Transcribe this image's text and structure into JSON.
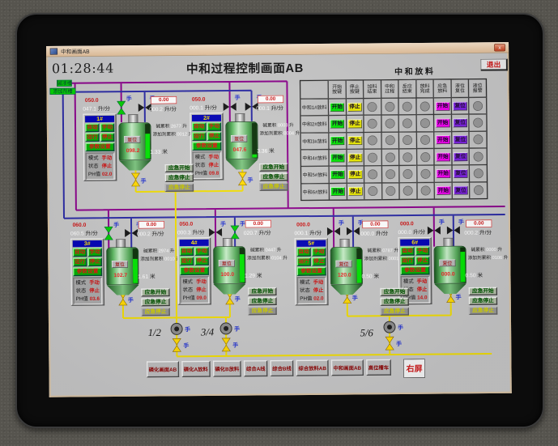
{
  "window": {
    "title": "中和画面AB",
    "clock": "01:28:44",
    "main_title": "中和过程控制画面AB",
    "exit": "退出",
    "close": "x"
  },
  "sources": {
    "box1": "碱液槽",
    "box2": "添加剂槽"
  },
  "labels": {
    "hand": "手",
    "auto": "自动",
    "manual": "手动",
    "run": "运行",
    "stop": "停止",
    "params": "参数设置",
    "mode": "模式",
    "state": "状态",
    "ph": "PH值",
    "reset": "复位",
    "em_start": "应急开始",
    "em_stop": "应急停止",
    "acc1": "碱累积",
    "acc2": "添加剂累积",
    "unit_vol": "升",
    "unit_flow": "升/分",
    "unit_level": "米"
  },
  "groups": [
    {
      "tag": "1#",
      "mode": "手动",
      "state": "停止",
      "ph": "02.0",
      "set": "050.0",
      "act": "047.1",
      "meter": "0.00",
      "meter_act": "000.2",
      "acc1": "2677",
      "acc2": "0012",
      "level": "098.2",
      "height": "1.33",
      "fill": 72
    },
    {
      "tag": "2#",
      "mode": "手动",
      "state": "停止",
      "ph": "09.8",
      "set": "050.0",
      "act": "000.1",
      "meter": "0.00",
      "meter_act": "000.1",
      "acc1": "0003",
      "acc2": "0004",
      "level": "047.6",
      "height": "3.36",
      "fill": 10
    },
    {
      "tag": "3#",
      "mode": "手动",
      "state": "停止",
      "ph": "03.6",
      "set": "060.0",
      "act": "060.5",
      "meter": "0.00",
      "meter_act": "000.2",
      "acc1": "2974",
      "acc2": "0010",
      "level": "102.7",
      "height": "1.61",
      "fill": 70
    },
    {
      "tag": "4#",
      "mode": "手动",
      "state": "停止",
      "ph": "09.0",
      "set": "050.0",
      "act": "000.3",
      "meter": "0.00",
      "meter_act": "020.7",
      "acc1": "0447",
      "acc2": "0104",
      "level": "100.0",
      "height": "1.29",
      "fill": 82
    },
    {
      "tag": "5#",
      "mode": "手动",
      "state": "停止",
      "ph": "02.0",
      "set": "000.0",
      "act": "000.1",
      "meter": "0.00",
      "meter_act": "000.0",
      "acc1": "0787",
      "acc2": "0001",
      "level": "120.0",
      "height": "0.50",
      "fill": 68
    },
    {
      "tag": "6#",
      "mode": "手动",
      "state": "停止",
      "ph": "14.0",
      "set": "000.0",
      "act": "000.0",
      "meter": "0.00",
      "meter_act": "000.2",
      "acc1": "0000",
      "acc2": "0106",
      "level": "000.0",
      "height": "0.50",
      "fill": 88
    }
  ],
  "pumps": [
    {
      "label": "1/2"
    },
    {
      "label": "3/4"
    },
    {
      "label": "5/6"
    }
  ],
  "table": {
    "title": "中和放料",
    "headers": [
      {
        "a": "开始",
        "b": "按键"
      },
      {
        "a": "停止",
        "b": "按键"
      },
      {
        "a": "加料",
        "b": "结束"
      },
      {
        "a": "中和",
        "b": "过程"
      },
      {
        "a": "反应",
        "b": "结束"
      },
      {
        "a": "放料",
        "b": "完成"
      },
      {
        "a": "应急",
        "b": "放料"
      },
      {
        "a": "液位",
        "b": "复位"
      },
      {
        "a": "液位",
        "b": "报警"
      }
    ],
    "btn": {
      "start": "开始",
      "stop": "停止",
      "em": "开始",
      "reset": "复位"
    },
    "rows": [
      {
        "label": "中和1#放料"
      },
      {
        "label": "中和2#放料"
      },
      {
        "label": "中和3#放料"
      },
      {
        "label": "中和4#放料"
      },
      {
        "label": "中和5#放料"
      },
      {
        "label": "中和6#放料"
      }
    ]
  },
  "nav": {
    "items": [
      {
        "label": "磷化画面AB"
      },
      {
        "label": "磷化A放料"
      },
      {
        "label": "磷化B放料"
      },
      {
        "label": "综合A线"
      },
      {
        "label": "综合B线"
      },
      {
        "label": "综合放料AB"
      },
      {
        "label": "中和画面AB"
      },
      {
        "label": "高位槽车"
      }
    ],
    "right": "右屏"
  }
}
